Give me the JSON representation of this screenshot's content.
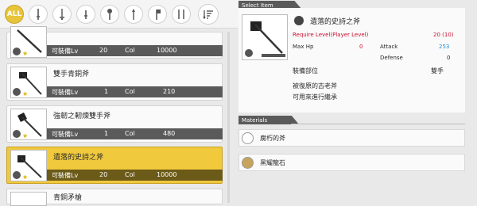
{
  "filters": {
    "all_label": "ALL",
    "tabs": [
      "one-handed-sword-icon",
      "rapier-icon",
      "dagger-icon",
      "mace-icon",
      "spear-icon",
      "axe-icon",
      "two-handed-icon"
    ],
    "sort_icon": "sort-icon"
  },
  "list": {
    "items": [
      {
        "name": "",
        "equip_label": "可裝備Lv",
        "lv": "20",
        "col_label": "Col",
        "col": "10000"
      },
      {
        "name": "雙手青銅斧",
        "equip_label": "可裝備Lv",
        "lv": "1",
        "col_label": "Col",
        "col": "210"
      },
      {
        "name": "強韌之軔煉雙手斧",
        "equip_label": "可裝備Lv",
        "lv": "1",
        "col_label": "Col",
        "col": "480"
      },
      {
        "name": "遺落的史詩之斧",
        "equip_label": "可裝備Lv",
        "lv": "20",
        "col_label": "Col",
        "col": "10000"
      },
      {
        "name": "青銅矛槍",
        "equip_label": "",
        "lv": "",
        "col_label": "",
        "col": ""
      }
    ]
  },
  "detail": {
    "header": "Select Item",
    "name": "遺落的史詩之斧",
    "require_label": "Require Level(Player Level)",
    "require_value": "20 (10)",
    "maxhp_label": "Max Hp",
    "maxhp_value": "0",
    "attack_label": "Attack",
    "attack_value": "253",
    "defense_label": "Defense",
    "defense_value": "0",
    "slot_label": "裝備部位",
    "slot_value": "雙手",
    "desc_line1": "被復原的古老斧",
    "desc_line2": "可用來進行繼承"
  },
  "materials": {
    "header": "Materials",
    "items": [
      {
        "name": "腐朽的斧",
        "icon": "axe-material-icon"
      },
      {
        "name": "黑耀龍石",
        "icon": "stone-material-icon"
      }
    ]
  },
  "colors": {
    "accent": "#f0c93c",
    "require": "#c8102e",
    "attack": "#2a8fd8"
  }
}
